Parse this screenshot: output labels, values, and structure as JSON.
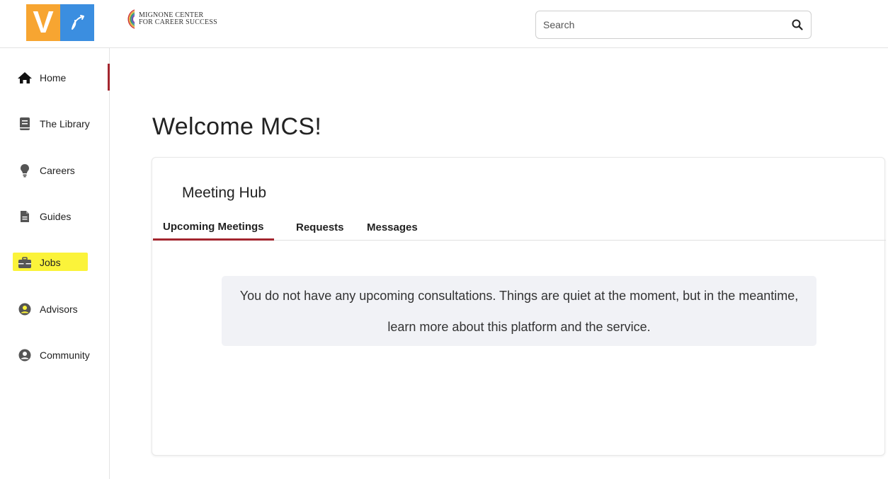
{
  "header": {
    "app_logo_letter": "V",
    "org_logo_line1": "MIGNONE CENTER",
    "org_logo_line2": "FOR CAREER SUCCESS",
    "search": {
      "placeholder": "Search",
      "value": ""
    }
  },
  "sidebar": {
    "items": [
      {
        "label": "Home",
        "icon": "home-icon"
      },
      {
        "label": "The Library",
        "icon": "book-icon"
      },
      {
        "label": "Careers",
        "icon": "lightbulb-icon"
      },
      {
        "label": "Guides",
        "icon": "document-icon"
      },
      {
        "label": "Jobs",
        "icon": "briefcase-icon"
      },
      {
        "label": "Advisors",
        "icon": "user-circle-icon"
      },
      {
        "label": "Community",
        "icon": "user-circle-icon"
      }
    ],
    "active_index": 0,
    "highlighted_index": 5
  },
  "main": {
    "title": "Welcome MCS!",
    "card": {
      "title": "Meeting Hub",
      "tabs": [
        {
          "label": "Upcoming Meetings",
          "active": true
        },
        {
          "label": "Requests",
          "active": false
        },
        {
          "label": "Messages",
          "active": false
        }
      ],
      "empty_message": "You do not have any upcoming consultations. Things are quiet at the moment, but in the meantime, learn more about this platform and the service."
    }
  },
  "colors": {
    "accent": "#a3262f",
    "logo_orange": "#f7a531",
    "logo_blue": "#3b8ee0",
    "highlight": "#fbf33a"
  }
}
